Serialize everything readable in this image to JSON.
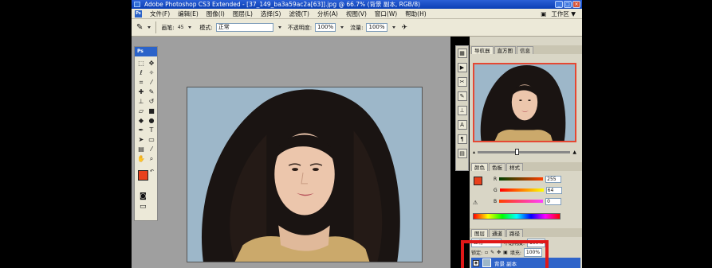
{
  "window": {
    "title": "Adobe Photoshop CS3 Extended - [37_149_ba3a59ac2a[63]].jpg @ 66.7% (背景 副本, RGB/8)"
  },
  "menu": {
    "items": [
      "文件(F)",
      "编辑(E)",
      "图像(I)",
      "图层(L)",
      "选择(S)",
      "滤镜(T)",
      "分析(A)",
      "视图(V)",
      "窗口(W)",
      "帮助(H)"
    ],
    "workspace_label": "工作区 ▼"
  },
  "options": {
    "brush_label": "画笔:",
    "brush_size": "45",
    "mode_label": "模式:",
    "mode_value": "正常",
    "opacity_label": "不透明度:",
    "opacity_value": "100%",
    "flow_label": "流量:",
    "flow_value": "100%"
  },
  "tools": {
    "header": "Ps"
  },
  "navigator": {
    "tabs": [
      "导航器",
      "直方图",
      "信息"
    ]
  },
  "color_panel": {
    "tabs": [
      "颜色",
      "色板",
      "样式"
    ],
    "channels": [
      {
        "label": "R",
        "value": "255"
      },
      {
        "label": "G",
        "value": "64"
      },
      {
        "label": "B",
        "value": "0"
      }
    ]
  },
  "layers_panel": {
    "tabs": [
      "图层",
      "通道",
      "路径"
    ],
    "blend_mode": "正常",
    "opacity_label": "不透明度:",
    "opacity_value": "100%",
    "lock_label": "锁定:",
    "fill_label": "填充:",
    "fill_value": "100%",
    "active_layer": "背景 副本"
  },
  "colors": {
    "foreground": "#e8401c",
    "background": "#ffffff",
    "highlight_box": "#e01818"
  }
}
